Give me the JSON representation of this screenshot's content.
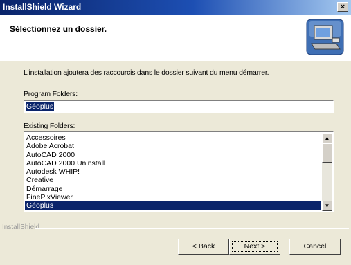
{
  "window": {
    "title": "InstallShield Wizard",
    "close_glyph": "×"
  },
  "header": {
    "heading": "Sélectionnez un dossier.",
    "logo_icon": "installshield-computer-icon"
  },
  "body": {
    "description": "L'installation ajoutera des raccourcis dans le dossier suivant du menu démarrer.",
    "program_folders_label": "Program Folders:",
    "program_folders_value": "Géoplus",
    "existing_folders_label": "Existing Folders:",
    "existing_folders": [
      "Accessoires",
      "Adobe Acrobat",
      "AutoCAD 2000",
      "AutoCAD 2000 Uninstall",
      "Autodesk WHIP!",
      "Creative",
      "Démarrage",
      "FinePixViewer",
      "Géoplus"
    ],
    "selected_folder": "Géoplus"
  },
  "footer": {
    "brand": "InstallShield",
    "back_label": "< Back",
    "next_label": "Next >",
    "cancel_label": "Cancel"
  },
  "colors": {
    "selection": "#0a246a",
    "dialog": "#ece9d8",
    "title_start": "#0a246a"
  }
}
